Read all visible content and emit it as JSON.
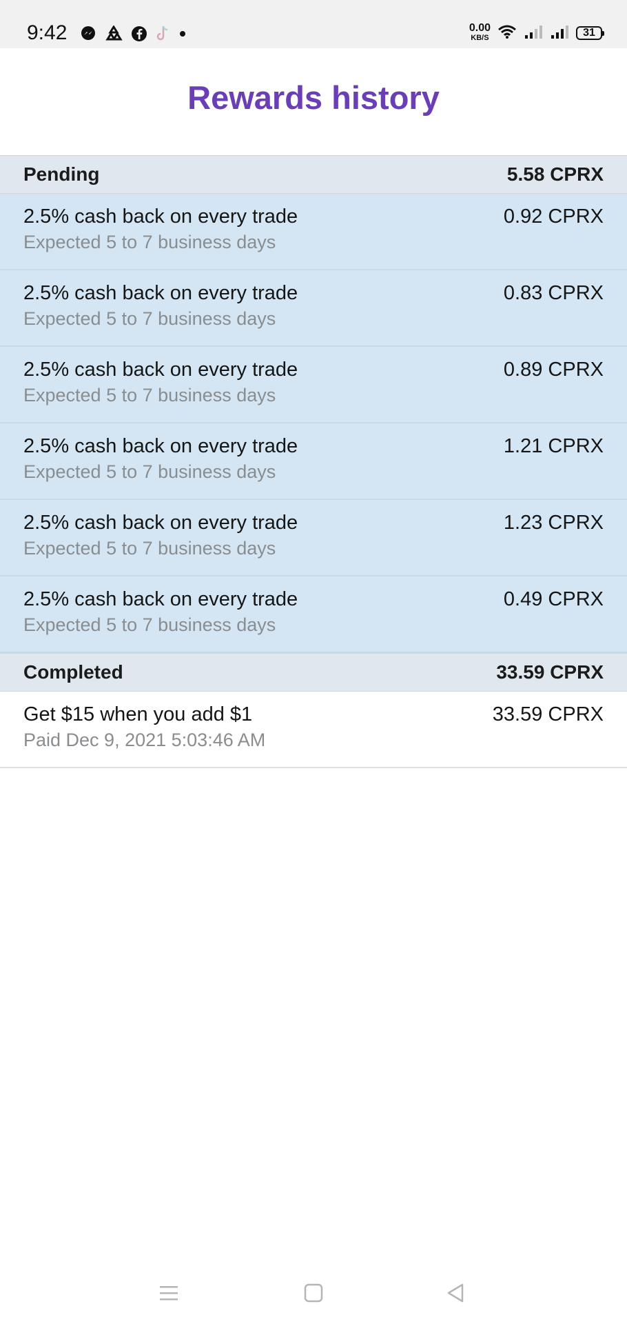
{
  "status_bar": {
    "time": "9:42",
    "net_speed_value": "0.00",
    "net_speed_unit": "KB/S",
    "battery": "31",
    "left_icons": [
      "messenger-icon",
      "recycle-icon",
      "facebook-icon",
      "tiktok-icon",
      "dot-icon"
    ],
    "right_icons": [
      "wifi-icon",
      "signal-icon",
      "signal-icon"
    ]
  },
  "header": {
    "title": "Rewards history"
  },
  "pending": {
    "label": "Pending",
    "total": "5.58 CPRX",
    "items": [
      {
        "title": "2.5% cash back on every trade",
        "subtitle": "Expected 5 to 7 business days",
        "amount": "0.92 CPRX"
      },
      {
        "title": "2.5% cash back on every trade",
        "subtitle": "Expected 5 to 7 business days",
        "amount": "0.83 CPRX"
      },
      {
        "title": "2.5% cash back on every trade",
        "subtitle": "Expected 5 to 7 business days",
        "amount": "0.89 CPRX"
      },
      {
        "title": "2.5% cash back on every trade",
        "subtitle": "Expected 5 to 7 business days",
        "amount": "1.21 CPRX"
      },
      {
        "title": "2.5% cash back on every trade",
        "subtitle": "Expected 5 to 7 business days",
        "amount": "1.23 CPRX"
      },
      {
        "title": "2.5% cash back on every trade",
        "subtitle": "Expected 5 to 7 business days",
        "amount": "0.49 CPRX"
      }
    ]
  },
  "completed": {
    "label": "Completed",
    "total": "33.59 CPRX",
    "items": [
      {
        "title": "Get $15 when you add $1",
        "subtitle": "Paid Dec 9, 2021 5:03:46 AM",
        "amount": "33.59 CPRX"
      }
    ]
  },
  "colors": {
    "title": "#6a3fb5",
    "section_header_bg": "#e1e7ee",
    "pending_row_bg": "#d4e6f3",
    "subtitle_text": "#8a8d90"
  },
  "nav_bar": {
    "buttons": [
      "menu-icon",
      "home-square-icon",
      "back-triangle-icon"
    ]
  }
}
